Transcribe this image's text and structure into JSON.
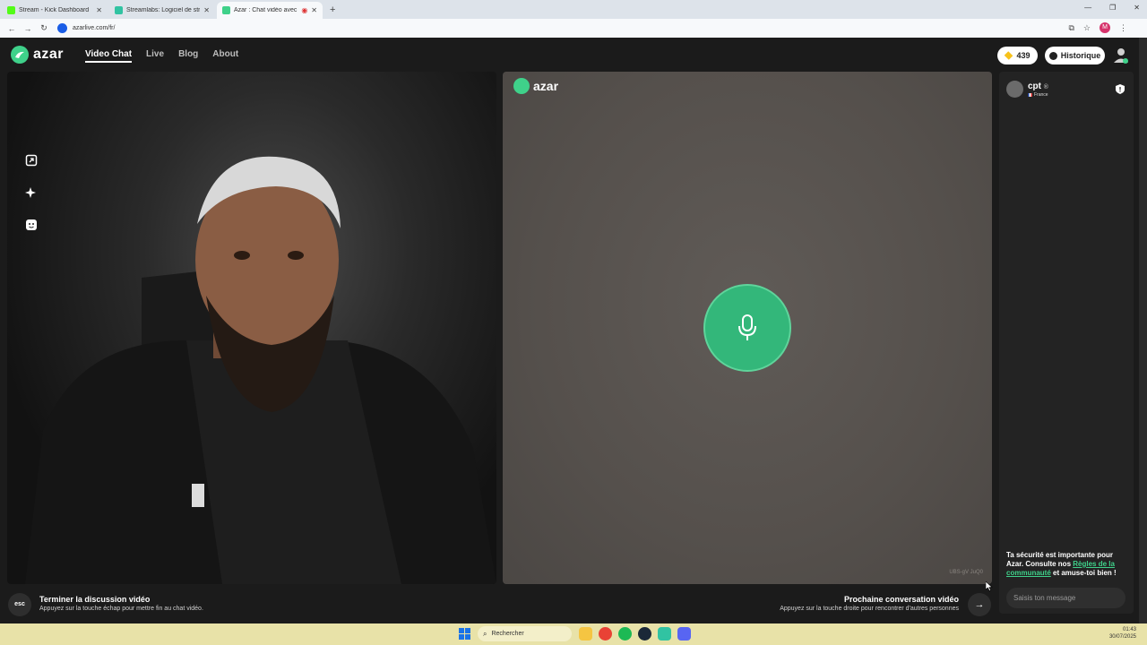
{
  "browser": {
    "tabs": [
      {
        "title": "Stream - Kick Dashboard",
        "favicon_color": "#53fc18",
        "active": false
      },
      {
        "title": "Streamlabs: Logiciel de streami",
        "favicon_color": "#31c3a2",
        "active": false
      },
      {
        "title": "Azar : Chat vidéo avec de n",
        "favicon_color": "#3fd18a",
        "active": true
      }
    ],
    "url": "azarlive.com/fr/",
    "profile_initial": "M"
  },
  "app": {
    "logo": "azar",
    "nav": [
      {
        "label": "Video Chat",
        "active": true
      },
      {
        "label": "Live",
        "active": false
      },
      {
        "label": "Blog",
        "active": false
      },
      {
        "label": "About",
        "active": false
      }
    ],
    "gems": "439",
    "history_label": "Historique",
    "accent_color": "#3fd18a"
  },
  "remote": {
    "logo": "azar",
    "id_text": "UBS-gV JuQ0"
  },
  "chat": {
    "peer_name": "cpt",
    "peer_country": "France",
    "safety_pre": "Ta sécurité est importante pour Azar. Consulte nos ",
    "safety_link": "Règles de la communauté",
    "safety_post": " et amuse-toi bien !",
    "input_placeholder": "Saisis ton message"
  },
  "bottom": {
    "esc_label": "esc",
    "end_title": "Terminer la discussion vidéo",
    "end_sub": "Appuyez sur la touche échap pour mettre fin au chat vidéo.",
    "next_title": "Prochaine conversation vidéo",
    "next_sub": "Appuyez sur la touche droite pour rencontrer d'autres personnes",
    "next_arrow": "→"
  },
  "taskbar": {
    "search_placeholder": "Rechercher",
    "time": "01:43",
    "date": "30/07/2025"
  }
}
